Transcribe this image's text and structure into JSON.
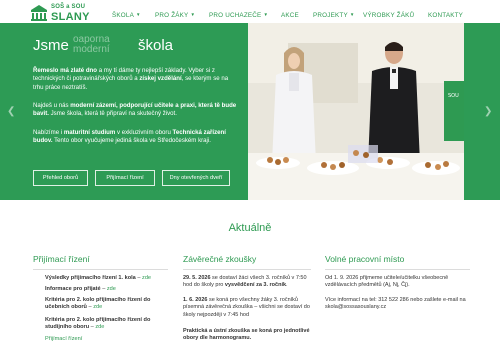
{
  "brand": {
    "top_line": "SOŠ a SOU",
    "name": "SLANY",
    "accent": "#2e9a52",
    "hero_bg": "#2d9b55"
  },
  "nav": {
    "items": [
      {
        "label": "Škola",
        "dropdown": true
      },
      {
        "label": "Pro žáky",
        "dropdown": true
      },
      {
        "label": "Pro uchazeče",
        "dropdown": true
      },
      {
        "label": "Akce",
        "dropdown": false
      },
      {
        "label": "Projekty",
        "dropdown": true
      },
      {
        "label": "Výrobky žáků",
        "dropdown": false
      },
      {
        "label": "Kontakty",
        "dropdown": false
      }
    ],
    "caret": "▼"
  },
  "hero": {
    "title_start": "Jsme",
    "title_rotating": [
      "oaporna",
      "moderní"
    ],
    "title_end": "škola",
    "p1": {
      "b1": "Řemeslo má zlaté dno",
      "t1": " a my tí dáme ty nejlepší základy. Vyber si z technických či potravinářských oborů a ",
      "b2": "získej vzdělání",
      "t2": ", se kterým se na trhu práce neztratíš."
    },
    "p2": {
      "t1": "Najdeš u nás ",
      "b1": "moderní zázemí, podporující učitele a praxi, která tě bude bavit.",
      "t2": " Jsme škola, která tě připraví na skutečný život."
    },
    "p3": {
      "t1": "Nabízíme i ",
      "b1": "maturitní studium",
      "t2": " v exkluzivním oboru ",
      "b2": "Technická zařízení budov.",
      "t3": " Tento obor vyučujeme jediná škola ve Středočeském kraji."
    },
    "buttons": [
      "Přehled oborů",
      "Přijímací řízení",
      "Dny otevřených dveří"
    ],
    "prev_arrow": "❮",
    "next_arrow": "❯",
    "photo_banner": "SOU SLANY"
  },
  "news": {
    "title": "Aktuálně",
    "col1": {
      "heading": "Přijímací řízení",
      "items": [
        {
          "bold": "Výsledky přijímacího řízení 1. kola",
          "sep": " – ",
          "link": "zde"
        },
        {
          "bold": "Informace pro přijaté",
          "sep": " – ",
          "link": "zde"
        },
        {
          "bold": "Kritéria pro 2. kolo přijímacího řízení do učebních oborů",
          "sep": " – ",
          "link": "zde"
        },
        {
          "bold": "Kritéria pro 2. kolo přijímacího řízení do studijního oboru",
          "sep": " – ",
          "link": "zde"
        }
      ],
      "bottom_link": "Přijímací řízení"
    },
    "col2": {
      "heading": "Závěrečné zkoušky",
      "items": [
        {
          "bold": "29. 5. 2026",
          "text": " se dostaví žáci všech 3. ročníků v 7:50 hod do školy pro ",
          "bold2": "vysvědčení za 3. ročník",
          "text2": "."
        },
        {
          "bold": "1. 6. 2026",
          "text": " se koná pro všechny žáky 3. ročníků písemná závěrečná zkouška – všichni se dostaví do školy nejpozději v 7:45 hod",
          "bold2": "",
          "text2": ""
        },
        {
          "bold": "",
          "text": "Praktická a ústní zkouška se koná pro jednotlivé obory dle harmonogramu.",
          "bold2": "",
          "text2": ""
        }
      ]
    },
    "col3": {
      "heading": "Volné pracovní místo",
      "items": [
        "Od 1. 9. 2026 přijmeme učitele/učitelku všeobecně vzdělávacích předmětů (Aj, Nj, Čj).",
        "Více informací na tel: 312 522 286 nebo zašlete e-mail na skola@sossasouslany.cz"
      ]
    }
  }
}
